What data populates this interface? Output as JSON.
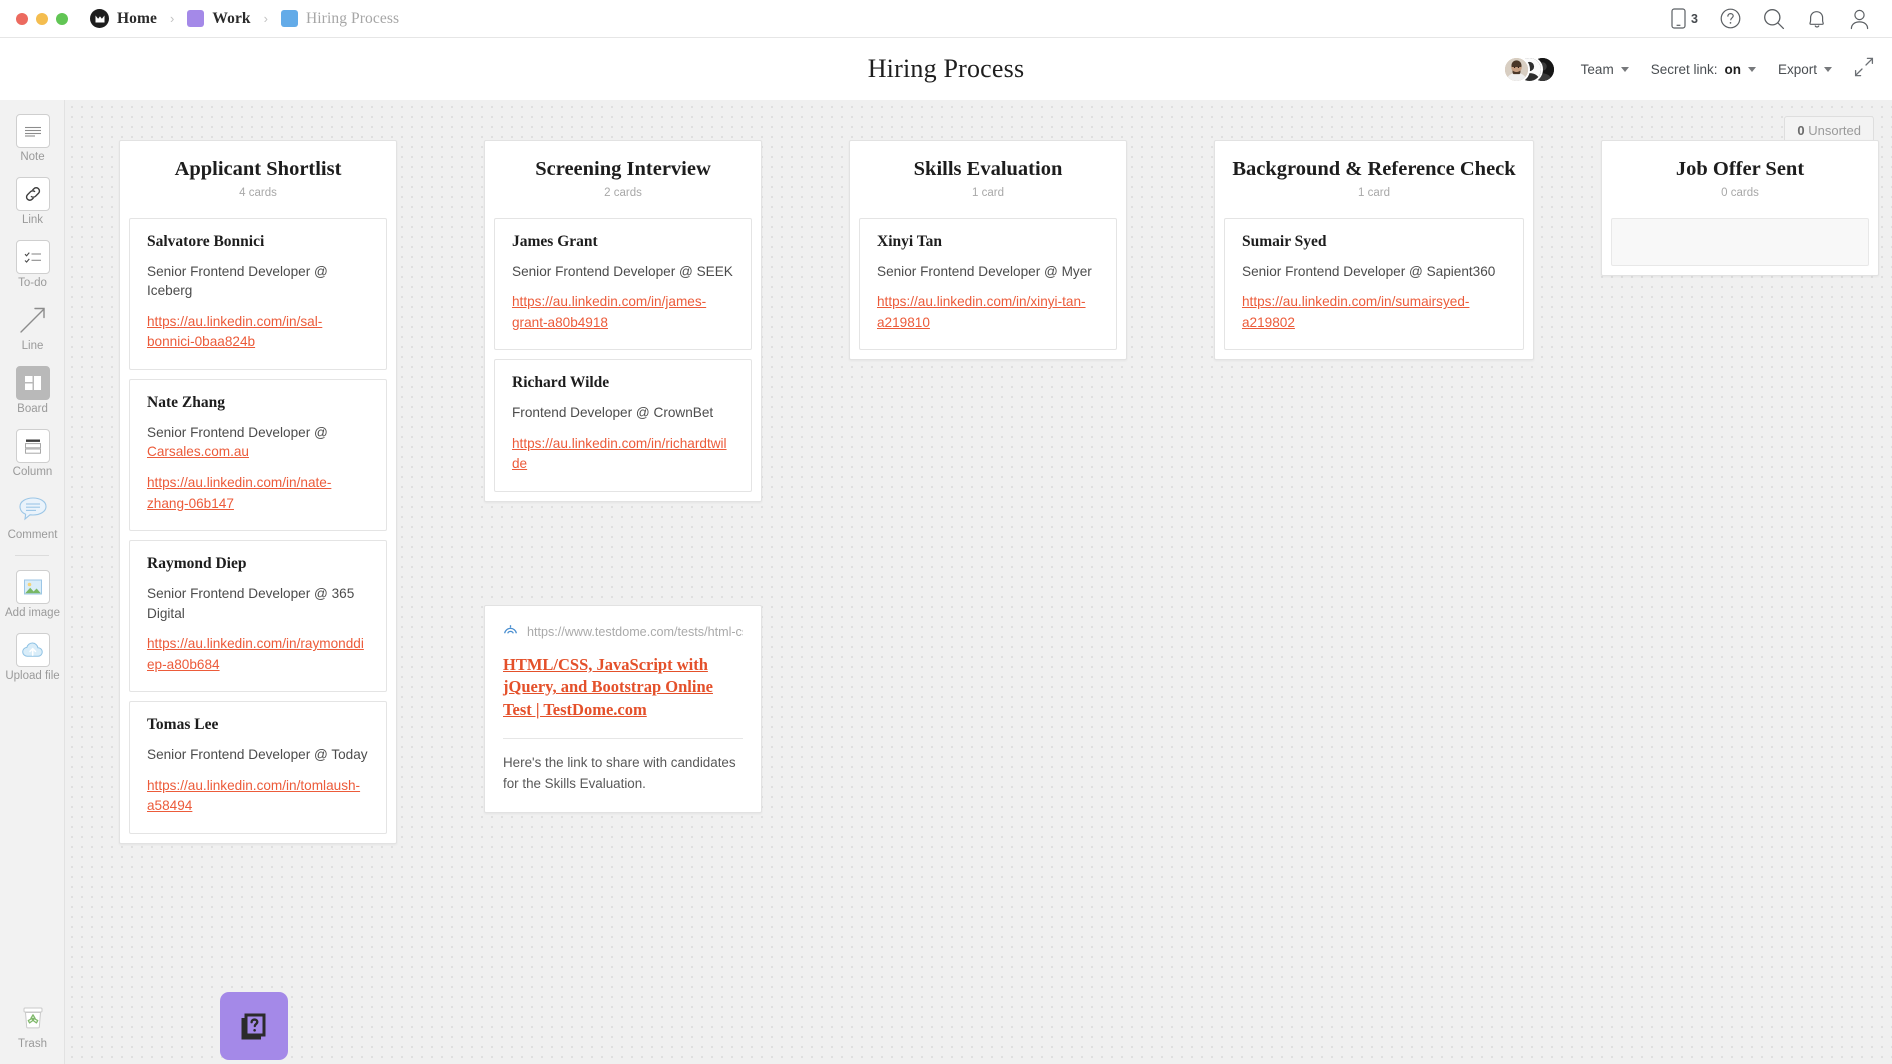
{
  "window": {
    "traffic_lights": [
      "close",
      "minimize",
      "zoom"
    ]
  },
  "breadcrumb": {
    "items": [
      {
        "label": "Home",
        "icon": "milanote-logo-icon",
        "muted": false
      },
      {
        "label": "Work",
        "icon": "purple-swatch-icon",
        "muted": false
      },
      {
        "label": "Hiring Process",
        "icon": "blue-swatch-icon",
        "muted": true
      }
    ],
    "separator": "›"
  },
  "topbar": {
    "mobile_count": "3",
    "icons": [
      "mobile-icon",
      "help-icon",
      "search-icon",
      "notifications-icon",
      "account-icon"
    ]
  },
  "board_header": {
    "title": "Hiring Process",
    "team_label": "Team",
    "secret_link_prefix": "Secret link: ",
    "secret_link_value": "on",
    "export_label": "Export",
    "fullscreen_icon": "expand-icon"
  },
  "tool_rail": {
    "items": [
      {
        "label": "Note",
        "icon": "note-icon",
        "active": false
      },
      {
        "label": "Link",
        "icon": "link-icon",
        "active": false
      },
      {
        "label": "To-do",
        "icon": "todo-icon",
        "active": false
      },
      {
        "label": "Line",
        "icon": "line-arrow-icon",
        "active": false
      },
      {
        "label": "Board",
        "icon": "board-icon",
        "active": true
      },
      {
        "label": "Column",
        "icon": "column-icon",
        "active": false
      },
      {
        "label": "Comment",
        "icon": "comment-icon",
        "active": false
      },
      {
        "label": "Add image",
        "icon": "image-icon",
        "active": false
      },
      {
        "label": "Upload file",
        "icon": "upload-cloud-icon",
        "active": false
      }
    ],
    "trash": {
      "label": "Trash",
      "icon": "trash-icon"
    }
  },
  "canvas": {
    "unsorted_count": "0",
    "unsorted_label": "Unsorted"
  },
  "columns": [
    {
      "title": "Applicant Shortlist",
      "count_label": "4 cards",
      "cards": [
        {
          "name": "Salvatore Bonnici",
          "role": "Senior Frontend Developer @ Iceberg",
          "role_link": "",
          "link": "https://au.linkedin.com/in/sal-bonnici-0baa824b"
        },
        {
          "name": "Nate Zhang",
          "role": "Senior Frontend Developer @ ",
          "role_link": "Carsales.com.au",
          "link": "https://au.linkedin.com/in/nate-zhang-06b147"
        },
        {
          "name": "Raymond Diep",
          "role": "Senior Frontend Developer @ 365 Digital",
          "role_link": "",
          "link": "https://au.linkedin.com/in/raymonddiep-a80b684"
        },
        {
          "name": "Tomas Lee",
          "role": "Senior Frontend Developer @ Today",
          "role_link": "",
          "link": "https://au.linkedin.com/in/tomlaush-a58494"
        }
      ]
    },
    {
      "title": "Screening Interview",
      "count_label": "2 cards",
      "cards": [
        {
          "name": "James Grant",
          "role": "Senior Frontend Developer @ SEEK",
          "role_link": "",
          "link": "https://au.linkedin.com/in/james-grant-a80b4918"
        },
        {
          "name": "Richard Wilde",
          "role": "Frontend Developer @ CrownBet",
          "role_link": "",
          "link": "https://au.linkedin.com/in/richardtwilde"
        }
      ]
    },
    {
      "title": "Skills Evaluation",
      "count_label": "1 card",
      "cards": [
        {
          "name": "Xinyi Tan",
          "role": "Senior Frontend Developer @ Myer",
          "role_link": "",
          "link": "https://au.linkedin.com/in/xinyi-tan-a219810"
        }
      ]
    },
    {
      "title": "Background & Reference Check",
      "count_label": "1 card",
      "cards": [
        {
          "name": "Sumair Syed",
          "role": "Senior Frontend Developer @ Sapient360",
          "role_link": "",
          "link": "https://au.linkedin.com/in/sumairsyed-a219802"
        }
      ]
    },
    {
      "title": "Job Offer Sent",
      "count_label": "0 cards",
      "cards": []
    }
  ],
  "link_card": {
    "favicon": "testdome-icon",
    "url": "https://www.testdome.com/tests/html-css-java",
    "title": "HTML/CSS, JavaScript with jQuery, and Bootstrap Online Test | TestDome.com",
    "note": "Here's the link to share with candidates for the Skills Evaluation."
  },
  "board_tile": {
    "icon": "question-cards-icon",
    "color": "#a489e8"
  },
  "colors": {
    "link": "#ec5b3a",
    "canvas_bg": "#f0f0f0",
    "rail_bg": "#f2f2f2",
    "accent_purple": "#a489e8"
  }
}
